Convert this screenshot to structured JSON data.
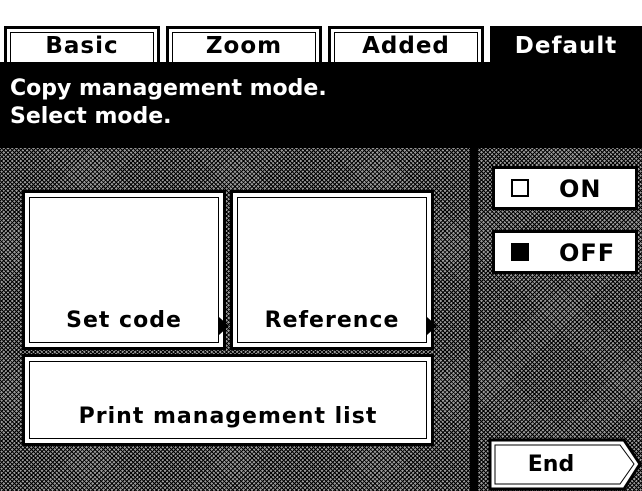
{
  "tabs": [
    {
      "label": "Basic",
      "active": false
    },
    {
      "label": "Zoom",
      "active": false
    },
    {
      "label": "Added",
      "active": false
    },
    {
      "label": "Default",
      "active": true
    }
  ],
  "message": {
    "line1": "Copy management mode.",
    "line2": "Select mode."
  },
  "buttons": {
    "set_code": "Set code",
    "reference": "Reference",
    "print_list": "Print management list"
  },
  "toggle": {
    "on_label": "ON",
    "off_label": "OFF",
    "selected": "OFF"
  },
  "end_label": "End",
  "icons": {
    "submenu_arrow": "right-triangle-icon",
    "checkbox": "square-checkbox-icon"
  }
}
